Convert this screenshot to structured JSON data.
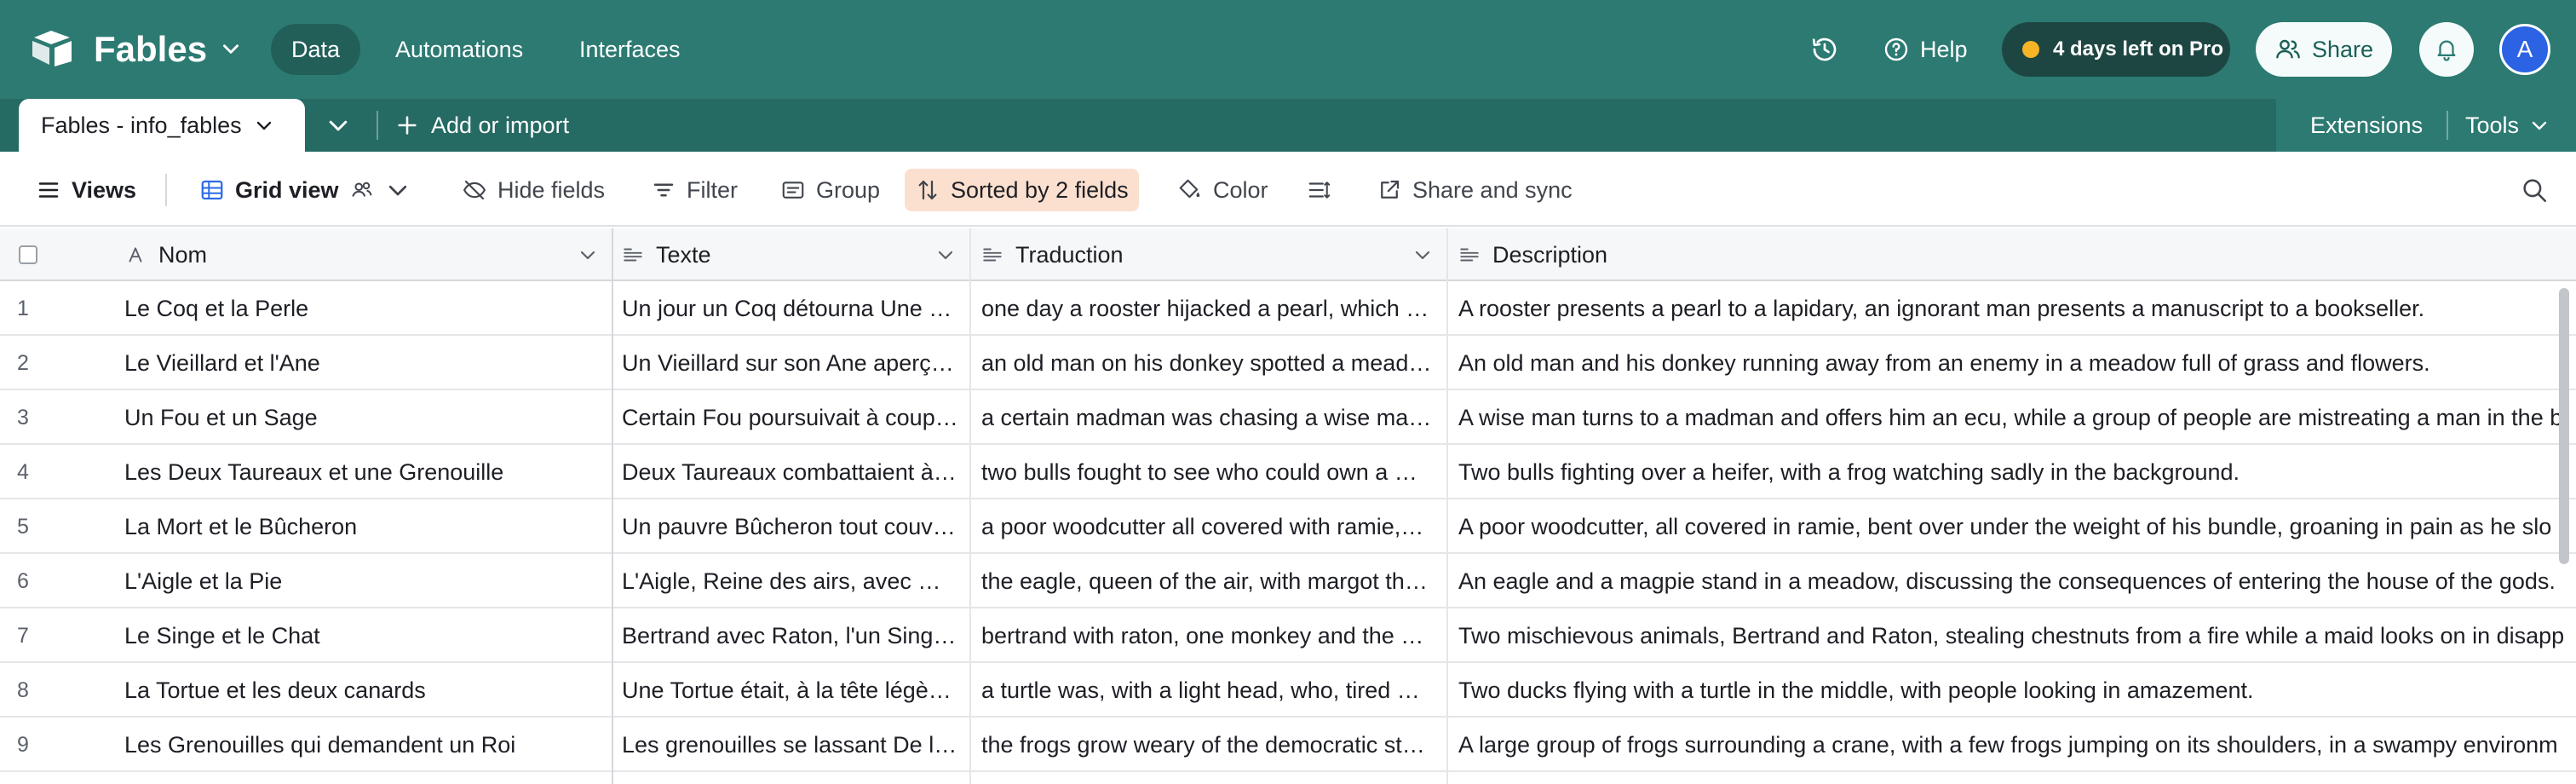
{
  "app": {
    "base_name": "Fables",
    "nav": {
      "data": "Data",
      "automations": "Automations",
      "interfaces": "Interfaces"
    },
    "help_label": "Help",
    "trial_label": "4 days left on Pro",
    "share_label": "Share",
    "avatar_initial": "A",
    "colors": {
      "header_bg": "#2c7a72",
      "tabbar_bg": "#256a63",
      "trial_dot": "#f5b526",
      "avatar": "#2b63e4",
      "sorted_bg": "#fbe0cf"
    }
  },
  "tabs": {
    "active_table": "Fables - info_fables",
    "add_import": "Add or import",
    "extensions": "Extensions",
    "tools": "Tools"
  },
  "toolbar": {
    "views": "Views",
    "view_name": "Grid view",
    "hide_fields": "Hide fields",
    "filter": "Filter",
    "group": "Group",
    "sort": "Sorted by 2 fields",
    "color": "Color",
    "share_sync": "Share and sync"
  },
  "grid": {
    "columns": [
      {
        "name": "Nom",
        "type_icon": "text-icon"
      },
      {
        "name": "Texte",
        "type_icon": "long-text-icon"
      },
      {
        "name": "Traduction",
        "type_icon": "long-text-icon"
      },
      {
        "name": "Description",
        "type_icon": "long-text-icon"
      }
    ],
    "rows": [
      {
        "num": "1",
        "nom": "Le Coq et la Perle",
        "texte": "Un jour un Coq détourna Une …",
        "traduction": "one day a rooster hijacked a pearl, which …",
        "description": "A rooster presents a pearl to a lapidary, an ignorant man presents a manuscript to a bookseller."
      },
      {
        "num": "2",
        "nom": "Le Vieillard et l'Ane",
        "texte": "Un Vieillard sur son Ane aperç…",
        "traduction": "an old man on his donkey spotted a mead…",
        "description": "An old man and his donkey running away from an enemy in a meadow full of grass and flowers."
      },
      {
        "num": "3",
        "nom": "Un Fou et un Sage",
        "texte": "Certain Fou poursuivait à coup…",
        "traduction": "a certain madman was chasing a wise ma…",
        "description": "A wise man turns to a madman and offers him an ecu, while a group of people are mistreating a man in the b"
      },
      {
        "num": "4",
        "nom": "Les Deux Taureaux et une Grenouille",
        "texte": "Deux Taureaux combattaient à…",
        "traduction": "two bulls fought to see who could own a …",
        "description": "Two bulls fighting over a heifer, with a frog watching sadly in the background."
      },
      {
        "num": "5",
        "nom": "La Mort et le Bûcheron",
        "texte": "Un pauvre Bûcheron tout couv…",
        "traduction": "a poor woodcutter all covered with ramie,…",
        "description": "A poor woodcutter, all covered in ramie, bent over under the weight of his bundle, groaning in pain as he slo"
      },
      {
        "num": "6",
        "nom": "L'Aigle et la Pie",
        "texte": "L'Aigle, Reine des airs, avec M…",
        "traduction": "the eagle, queen of the air, with margot th…",
        "description": "An eagle and a magpie stand in a meadow, discussing the consequences of entering the house of the gods."
      },
      {
        "num": "7",
        "nom": "Le Singe et le Chat",
        "texte": "Bertrand avec Raton, l'un Sing…",
        "traduction": "bertrand with raton, one monkey and the …",
        "description": "Two mischievous animals, Bertrand and Raton, stealing chestnuts from a fire while a maid looks on in disapp"
      },
      {
        "num": "8",
        "nom": "La Tortue et les deux canards",
        "texte": "Une Tortue était, à la tête légè…",
        "traduction": "a turtle was, with a light head, who, tired …",
        "description": "Two ducks flying with a turtle in the middle, with people looking in amazement."
      },
      {
        "num": "9",
        "nom": "Les Grenouilles qui demandent un Roi",
        "texte": "Les grenouilles se lassant De l…",
        "traduction": "the frogs grow weary of the democratic st…",
        "description": "A large group of frogs surrounding a crane, with a few frogs jumping on its shoulders, in a swampy environm"
      }
    ]
  }
}
